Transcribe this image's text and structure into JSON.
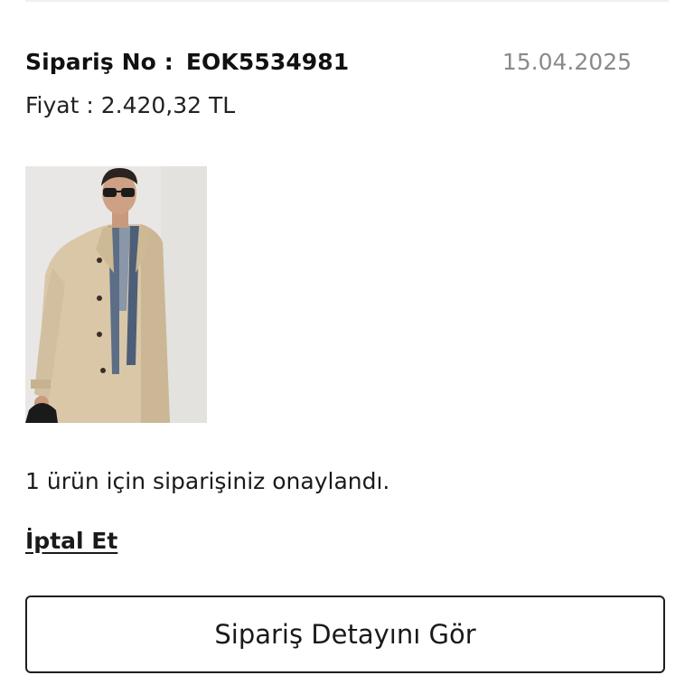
{
  "order": {
    "number_label": "Sipariş No :",
    "number_value": "EOK5534981",
    "date": "15.04.2025",
    "price": "Fiyat : 2.420,32 TL"
  },
  "product": {
    "image_description": "product-photo-beige-trench-coat"
  },
  "status": {
    "message": "1 ürün için siparişiniz onaylandı."
  },
  "actions": {
    "cancel_label": "İptal Et",
    "details_label": "Sipariş Detayını Gör"
  }
}
